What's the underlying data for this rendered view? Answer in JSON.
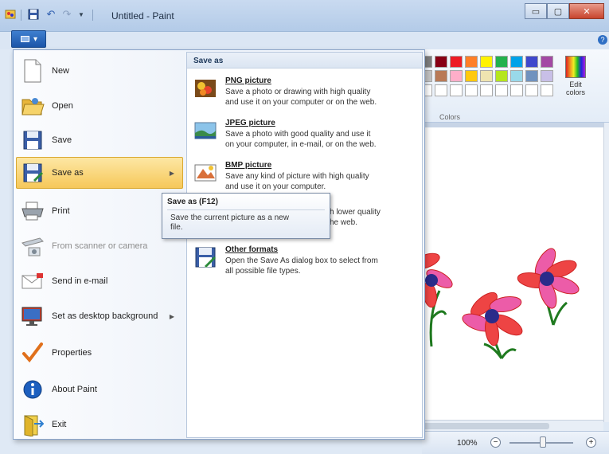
{
  "window": {
    "title": "Untitled - Paint",
    "controls": {
      "minimize": "▭",
      "maximize": "▢",
      "close": "✕"
    }
  },
  "quick_access": {
    "icons": [
      "paint-app-icon",
      "save-icon",
      "undo-icon",
      "redo-icon",
      "customize-dropdown-icon"
    ]
  },
  "app_button": {
    "label": "▾"
  },
  "menu": {
    "items": [
      {
        "label": "New",
        "icon": "new-document-icon"
      },
      {
        "label": "Open",
        "icon": "open-folder-icon"
      },
      {
        "label": "Save",
        "icon": "save-icon"
      },
      {
        "label": "Save as",
        "icon": "save-as-icon",
        "highlighted": true,
        "has_submenu": true
      },
      {
        "label": "Print",
        "icon": "printer-icon"
      },
      {
        "label": "From scanner or camera",
        "icon": "scanner-icon",
        "disabled": true
      },
      {
        "label": "Send in e-mail",
        "icon": "email-icon"
      },
      {
        "label": "Set as desktop background",
        "icon": "desktop-icon",
        "has_submenu": true
      },
      {
        "label": "Properties",
        "icon": "checkmark-icon"
      },
      {
        "label": "About Paint",
        "icon": "info-icon"
      },
      {
        "label": "Exit",
        "icon": "exit-icon"
      }
    ]
  },
  "save_as": {
    "header": "Save as",
    "formats": [
      {
        "title": "PNG picture",
        "desc_1": "Save a photo or drawing with high quality",
        "desc_2": "and use it on your computer or on the web.",
        "icon": "png-picture-icon"
      },
      {
        "title": "JPEG picture",
        "desc_1": "Save a photo with good quality and use it",
        "desc_2": "on your computer, in e-mail, or on the web.",
        "icon": "jpeg-picture-icon"
      },
      {
        "title": "BMP picture",
        "desc_1": "Save any kind of picture with high quality",
        "desc_2": "and use it on your computer.",
        "icon": "bmp-picture-icon"
      },
      {
        "title": "",
        "desc_1": "h lower quality",
        "desc_2": "he web.",
        "icon": "gif-picture-icon"
      },
      {
        "title": "Other formats",
        "desc_1": "Open the Save As dialog box to select from",
        "desc_2": "all possible file types.",
        "icon": "other-formats-icon"
      }
    ]
  },
  "tooltip": {
    "title": "Save as (F12)",
    "desc_1": "Save the current picture as a new",
    "desc_2": "file."
  },
  "ribbon": {
    "edit_colors_1": "Edit",
    "edit_colors_2": "colors",
    "colors_label": "Colors",
    "palette_row1": [
      "#000000",
      "#7f7f7f",
      "#880015",
      "#ed1c24",
      "#ff7f27",
      "#fff200",
      "#22b14c",
      "#00a2e8",
      "#3f48cc",
      "#a349a4"
    ],
    "palette_row2": [
      "#ffffff",
      "#c3c3c3",
      "#b97a57",
      "#ffaec9",
      "#ffc90e",
      "#efe4b0",
      "#b5e61d",
      "#99d9ea",
      "#7092be",
      "#c8bfe7"
    ]
  },
  "status": {
    "zoom": "100%",
    "zoom_out": "−",
    "zoom_in": "+"
  }
}
